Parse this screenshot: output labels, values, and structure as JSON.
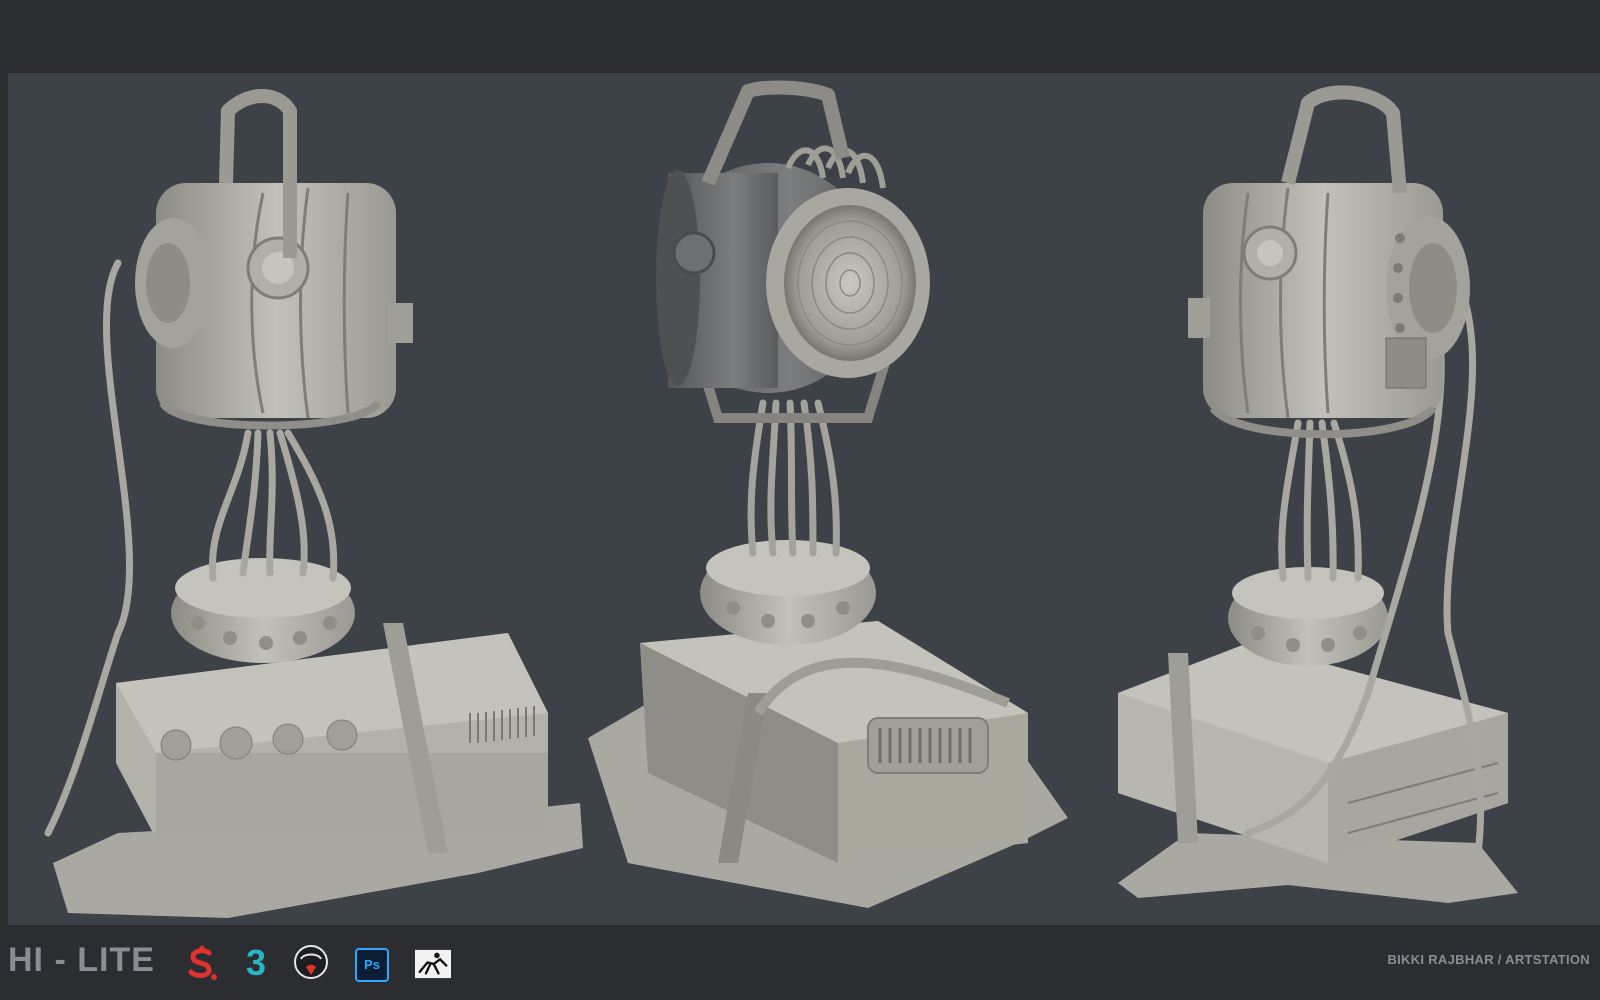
{
  "title": "HI - LITE",
  "credit": "BIKKI RAJBHAR / ARTSTATION",
  "tools": [
    {
      "name": "substance-painter-icon",
      "glyph": "S"
    },
    {
      "name": "3ds-max-icon",
      "glyph": "3"
    },
    {
      "name": "marmoset-toolbag-icon",
      "glyph": ""
    },
    {
      "name": "photoshop-icon",
      "glyph": "Ps"
    },
    {
      "name": "zbrush-icon",
      "glyph": ""
    }
  ],
  "colors": {
    "background": "#3d4249",
    "frame": "#2b2d31",
    "model": "#b9b8b0",
    "text": "#8a8d92",
    "substance_red": "#e0322e",
    "max_teal": "#2bb6c8",
    "photoshop_blue": "#31a8ff"
  },
  "render_views": [
    "left-three-quarter",
    "front",
    "right-three-quarter"
  ]
}
